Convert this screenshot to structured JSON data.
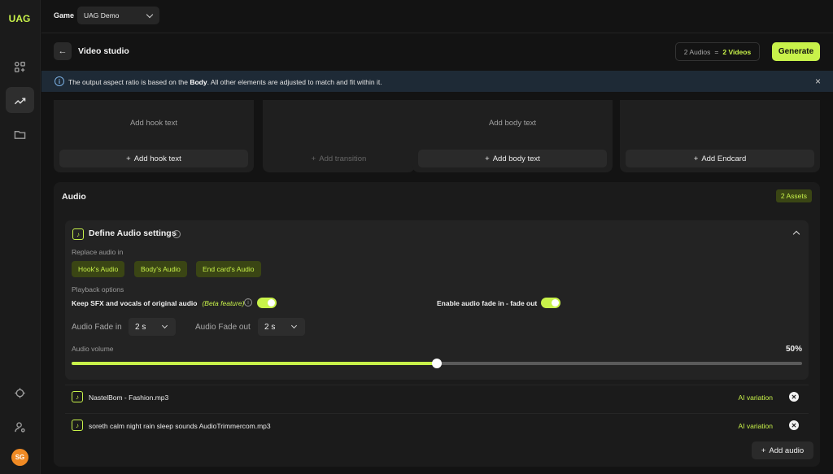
{
  "app": {
    "logo": "UAG",
    "avatar_initials": "SG"
  },
  "topbar": {
    "game_label": "Game",
    "game_value": "UAG Demo"
  },
  "header": {
    "title": "Video studio",
    "audios_count": "2 Audios",
    "equals": "=",
    "videos_count": "2 Videos",
    "generate_label": "Generate"
  },
  "banner": {
    "text_before": "The output aspect ratio is based on the ",
    "text_bold": "Body",
    "text_after": ". All other elements are adjusted to match and fit within it.",
    "close": "×"
  },
  "cards": [
    {
      "hint": "Add hook text",
      "button": "Add hook text"
    },
    {
      "hint": "",
      "button": "Add transition"
    },
    {
      "hint": "Add body text",
      "button": "Add body text"
    },
    {
      "hint": "",
      "button": "Add Endcard"
    }
  ],
  "audio": {
    "title": "Audio",
    "assets_badge": "2 Assets",
    "settings_title": "Define Audio settings",
    "replace_label": "Replace audio in",
    "replace_chips": [
      "Hook's Audio",
      "Body's Audio",
      "End card's Audio"
    ],
    "playback_label": "Playback options",
    "keep_sfx_label": "Keep SFX and vocals of original audio",
    "beta_label": "(Beta feature)",
    "keep_sfx_on": true,
    "fade_toggle_label": "Enable audio fade in - fade out",
    "fade_toggle_on": true,
    "fade_in_label": "Audio Fade in",
    "fade_in_value": "2 s",
    "fade_out_label": "Audio Fade out",
    "fade_out_value": "2 s",
    "volume_label": "Audio volume",
    "volume_text": "50%",
    "volume_fraction": 0.5,
    "files": [
      {
        "name": "NastelBom - Fashion.mp3",
        "action": "AI variation"
      },
      {
        "name": "soreth calm night rain sleep sounds AudioTrimmercom.mp3",
        "action": "AI variation"
      }
    ],
    "add_audio_label": "Add audio"
  },
  "colors": {
    "accent": "#c8f24a",
    "background": "#131313",
    "panel": "#1b1b1b"
  }
}
